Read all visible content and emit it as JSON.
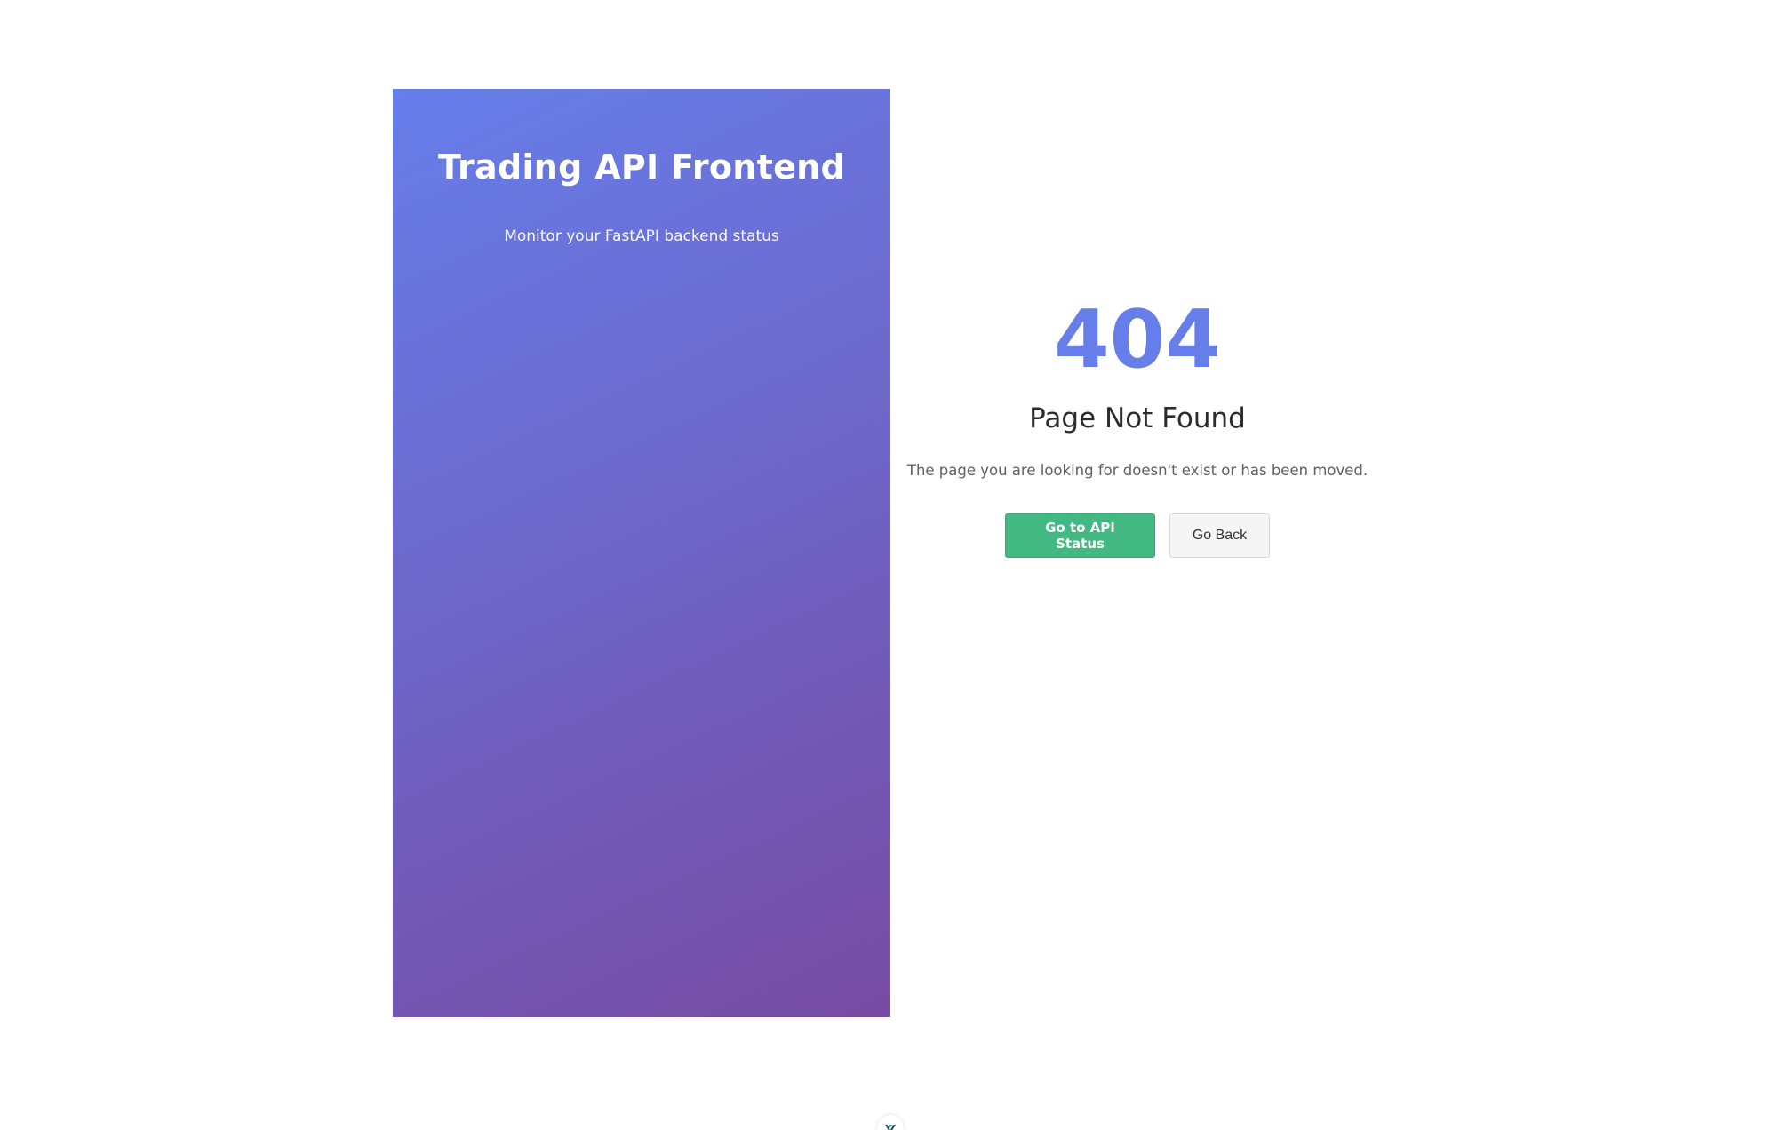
{
  "hero": {
    "title": "Trading API Frontend",
    "subtitle": "Monitor your FastAPI backend status"
  },
  "not_found": {
    "code": "404",
    "title": "Page Not Found",
    "description": "The page you are looking for doesn't exist or has been moved.",
    "primary_button_label": "Go to API Status",
    "secondary_button_label": "Go Back"
  },
  "devtools": {
    "icon": "vue-devtools-icon"
  },
  "colors": {
    "gradient_start": "#667eea",
    "gradient_end": "#764ba2",
    "accent": "#667eea",
    "primary_button": "#42b883"
  }
}
